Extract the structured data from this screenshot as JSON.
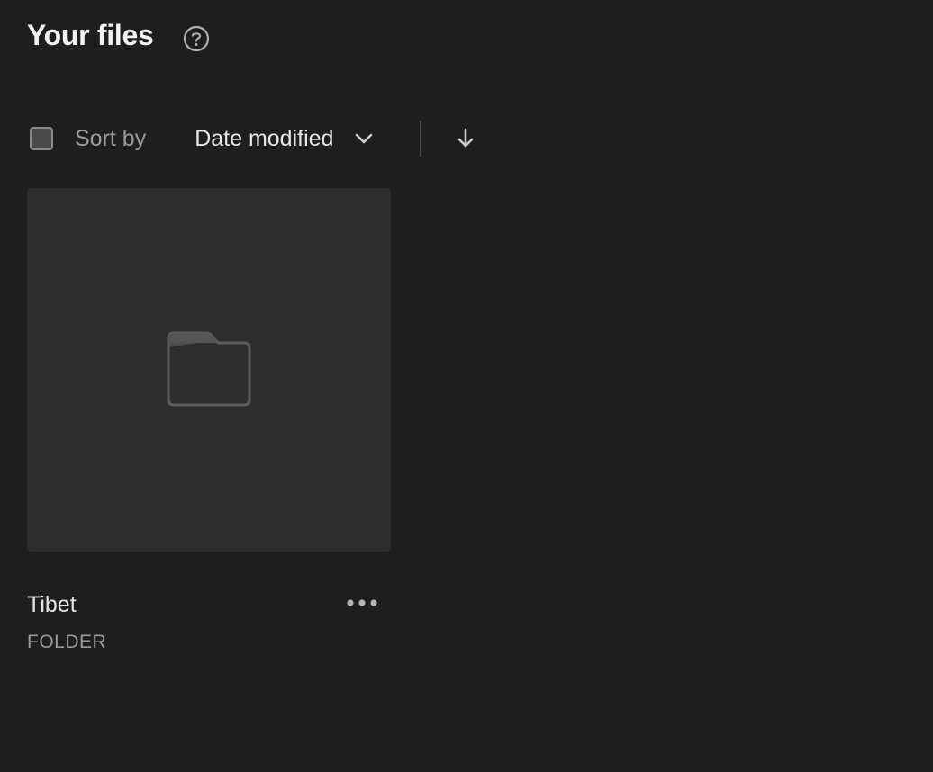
{
  "header": {
    "title": "Your files",
    "help_icon": "help-circle-icon"
  },
  "toolbar": {
    "select_all_checked": false,
    "sort_label": "Sort by",
    "sort_value": "Date modified",
    "sort_dropdown_icon": "chevron-down-icon",
    "sort_direction_icon": "arrow-down-icon"
  },
  "files": [
    {
      "name": "Tibet",
      "type": "FOLDER",
      "thumbnail_icon": "folder-icon",
      "menu_icon": "more-horizontal-icon"
    }
  ],
  "colors": {
    "background": "#1e1e1e",
    "card": "#2d2d2d",
    "muted_text": "#9a9a9a"
  }
}
